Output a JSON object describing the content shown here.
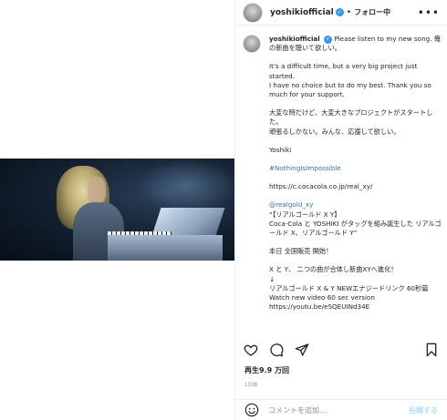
{
  "header": {
    "username": "yoshikiofficial",
    "separator": "•",
    "follow_state": "フォロー中",
    "more": "•••"
  },
  "caption": {
    "username": "yoshikiofficial",
    "intro": "Please listen to my new song. 俺の新曲を聴いて欲しい。",
    "p1": "It's a difficult time, but a very big project just started.\nI have no choice but to do my best. Thank you so much for your support.",
    "p2": "大変な時だけど、大変大きなプロジェクトがスタートした。\n頑張るしかない。みんな、応援して欲しい。",
    "signature": "Yoshiki",
    "hashtag": "#NothingIsImpossible",
    "url1": "https://c.cocacola.co.jp/real_xy/",
    "mention": "@realgold_xy",
    "p3": "“【リアルゴールド X Y】\nCoca-Cola と YOSHIKI がタッグを組み誕生した リアルゴールド X、リアルゴールド Y”",
    "p4": "本日 全国販売 開始！",
    "p5": "X と Y、 二つの曲が合体し新曲XYへ進化！\n↓\nリアルゴールド X & Y NEWエナジードリンク 60秒篇 Watch new video 60 sec version",
    "url2": "https://youtu.be/eSQEUINd34E"
  },
  "stats": {
    "views": "再生9.9 万回",
    "time": "1日前"
  },
  "comment": {
    "placeholder": "コメントを追加...",
    "post_label": "投稿する"
  },
  "icons": {
    "verified": "verified-badge-icon",
    "like": "heart-icon",
    "comment": "comment-icon",
    "share": "paper-plane-icon",
    "save": "bookmark-icon",
    "emoji": "smiley-icon"
  },
  "colors": {
    "verified": "#3897f0",
    "link": "#00376b",
    "post_disabled": "#b2dffc"
  }
}
